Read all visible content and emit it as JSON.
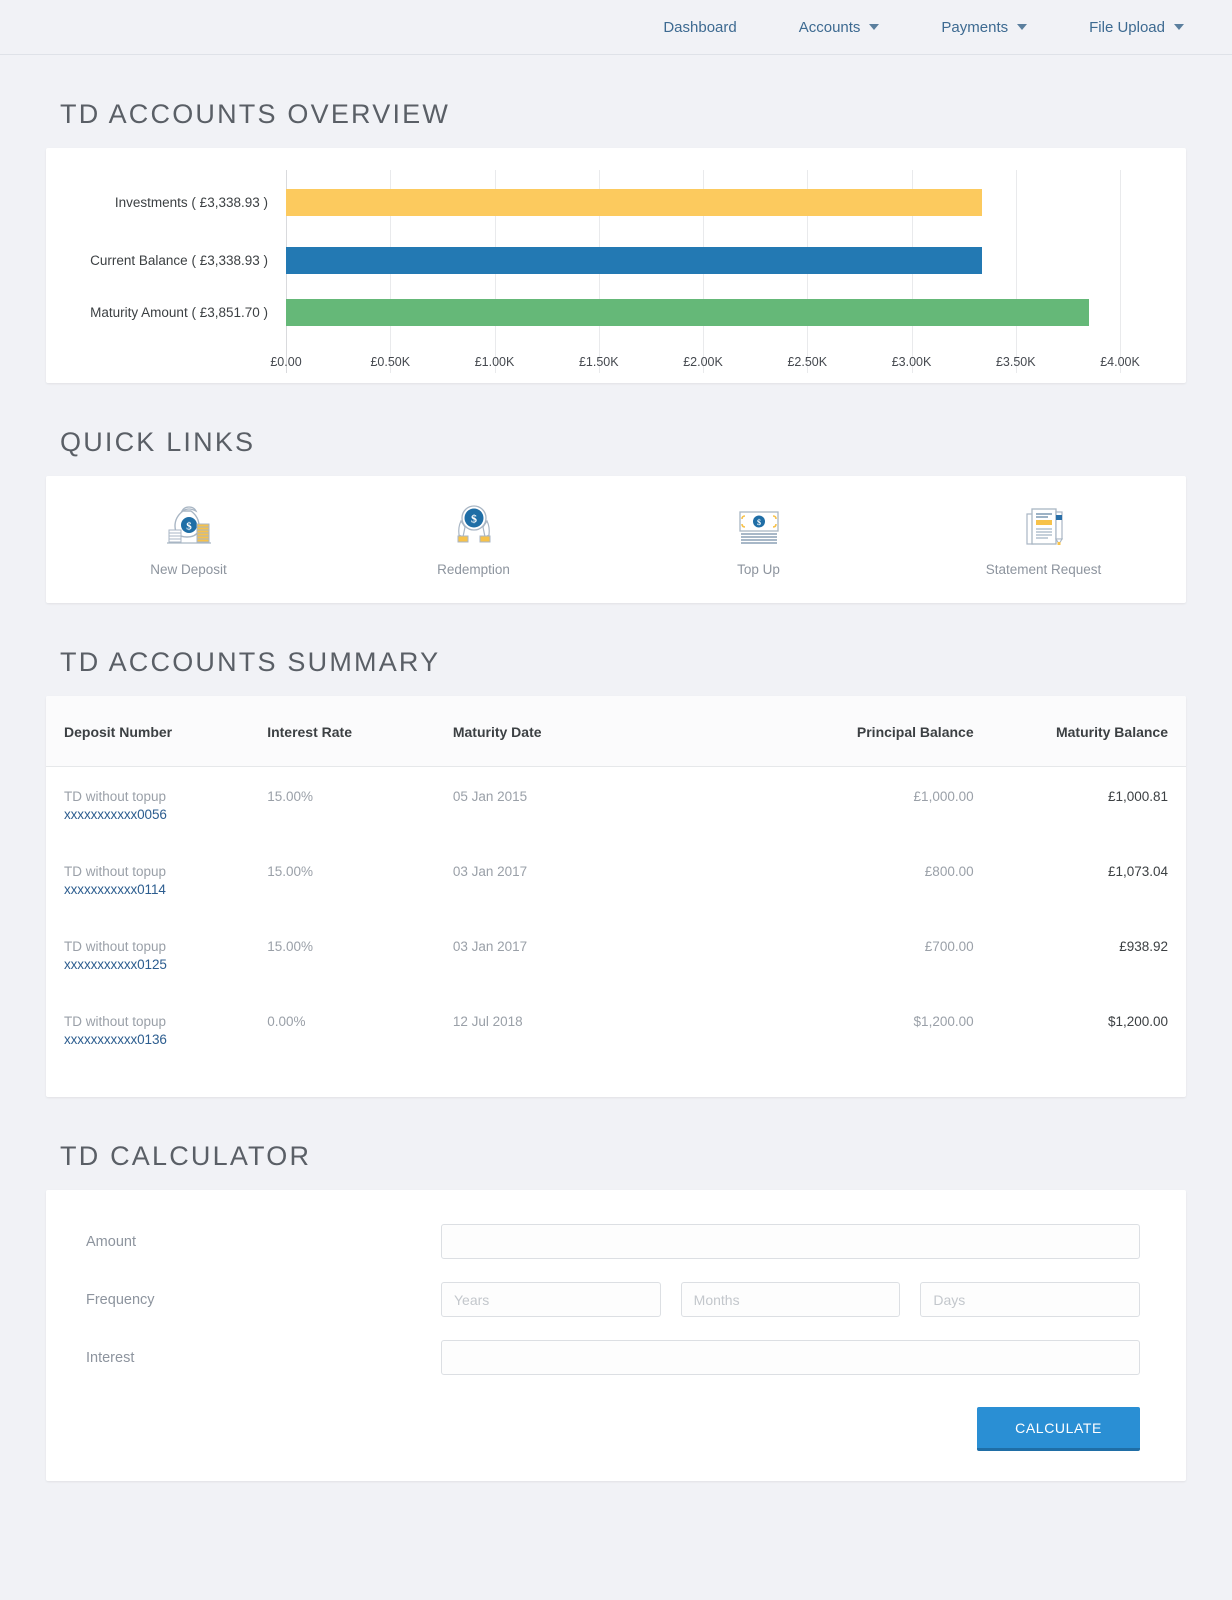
{
  "nav": {
    "items": [
      {
        "label": "Dashboard",
        "has_caret": false
      },
      {
        "label": "Accounts",
        "has_caret": true
      },
      {
        "label": "Payments",
        "has_caret": true
      },
      {
        "label": "File Upload",
        "has_caret": true
      }
    ]
  },
  "overview": {
    "title": "TD ACCOUNTS OVERVIEW"
  },
  "chart_data": {
    "type": "bar",
    "orientation": "horizontal",
    "title": "TD ACCOUNTS OVERVIEW",
    "categories": [
      "Investments ( £3,338.93 )",
      "Current Balance ( £3,338.93 )",
      "Maturity Amount ( £3,851.70 )"
    ],
    "values": [
      3338.93,
      3338.93,
      3851.7
    ],
    "colors": [
      "#fcca5e",
      "#2379b3",
      "#65b878"
    ],
    "xlabel": "",
    "ylabel": "",
    "xlim": [
      0,
      4000
    ],
    "tick_labels": [
      "£0.00",
      "£0.50K",
      "£1.00K",
      "£1.50K",
      "£2.00K",
      "£2.50K",
      "£3.00K",
      "£3.50K",
      "£4.00K"
    ],
    "tick_values": [
      0,
      500,
      1000,
      1500,
      2000,
      2500,
      3000,
      3500,
      4000
    ],
    "grid": true,
    "legend": false
  },
  "quick_links": {
    "title": "QUICK LINKS",
    "items": [
      {
        "label": "New Deposit",
        "icon": "money-bag-icon"
      },
      {
        "label": "Redemption",
        "icon": "hands-coin-icon"
      },
      {
        "label": "Top Up",
        "icon": "banknotes-icon"
      },
      {
        "label": "Statement Request",
        "icon": "document-pen-icon"
      }
    ]
  },
  "summary": {
    "title": "TD ACCOUNTS SUMMARY",
    "columns": [
      "Deposit Number",
      "Interest Rate",
      "Maturity Date",
      "Principal Balance",
      "Maturity Balance"
    ],
    "rows": [
      {
        "deposit_name": "TD without topup",
        "account_number": "xxxxxxxxxxx0056",
        "interest_rate": "15.00%",
        "maturity_date": "05 Jan 2015",
        "principal_balance": "£1,000.00",
        "maturity_balance": "£1,000.81"
      },
      {
        "deposit_name": "TD without topup",
        "account_number": "xxxxxxxxxxx0114",
        "interest_rate": "15.00%",
        "maturity_date": "03 Jan 2017",
        "principal_balance": "£800.00",
        "maturity_balance": "£1,073.04"
      },
      {
        "deposit_name": "TD without topup",
        "account_number": "xxxxxxxxxxx0125",
        "interest_rate": "15.00%",
        "maturity_date": "03 Jan 2017",
        "principal_balance": "£700.00",
        "maturity_balance": "£938.92"
      },
      {
        "deposit_name": "TD without topup",
        "account_number": "xxxxxxxxxxx0136",
        "interest_rate": "0.00%",
        "maturity_date": "12 Jul 2018",
        "principal_balance": "$1,200.00",
        "maturity_balance": "$1,200.00"
      }
    ]
  },
  "calculator": {
    "title": "TD CALCULATOR",
    "amount_label": "Amount",
    "amount_value": "",
    "amount_placeholder": "",
    "frequency_label": "Frequency",
    "years_placeholder": "Years",
    "years_value": "",
    "months_placeholder": "Months",
    "months_value": "",
    "days_placeholder": "Days",
    "days_value": "",
    "interest_label": "Interest",
    "interest_value": "",
    "interest_placeholder": "",
    "calculate_label": "CALCULATE"
  },
  "theme": {
    "accent": "#2a8fd4",
    "page_bg": "#f1f2f6",
    "link": "#2c5d8f"
  }
}
